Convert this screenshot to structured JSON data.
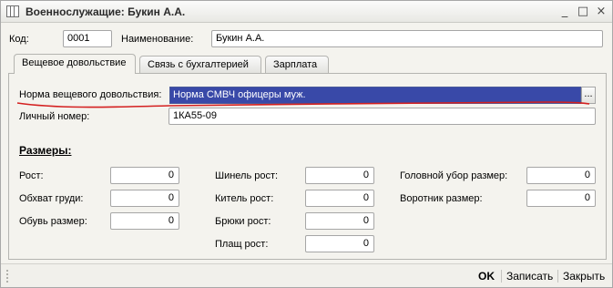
{
  "window": {
    "title": "Военнослужащие: Букин А.А.",
    "controls": {
      "minimize": "_",
      "maximize": "□",
      "close": "×"
    }
  },
  "header": {
    "code_label": "Код:",
    "code_value": "0001",
    "name_label": "Наименование:",
    "name_value": "Букин А.А."
  },
  "tabs": [
    {
      "label": "Вещевое довольствие",
      "active": true
    },
    {
      "label": "Связь с бухгалтерией",
      "active": false
    },
    {
      "label": "Зарплата",
      "active": false
    }
  ],
  "main": {
    "norm_label": "Норма вещевого довольствия:",
    "norm_value": "Норма СМВЧ офицеры муж.",
    "norm_button": "...",
    "personal_label": "Личный номер:",
    "personal_value": "1КА55-09",
    "sizes_heading": "Размеры:",
    "sizes": {
      "height_label": "Рост:",
      "height_value": "0",
      "chest_label": "Обхват груди:",
      "chest_value": "0",
      "shoe_label": "Обувь размер:",
      "shoe_value": "0",
      "greatcoat_label": "Шинель рост:",
      "greatcoat_value": "0",
      "tunic_label": "Китель рост:",
      "tunic_value": "0",
      "trousers_label": "Брюки рост:",
      "trousers_value": "0",
      "raincoat_label": "Плащ рост:",
      "raincoat_value": "0",
      "headwear_label": "Головной убор размер:",
      "headwear_value": "0",
      "collar_label": "Воротник размер:",
      "collar_value": "0"
    }
  },
  "footer": {
    "ok": "OK",
    "save": "Записать",
    "close": "Закрыть"
  },
  "colors": {
    "selection": "#3949a8",
    "annotation": "#d42020"
  }
}
